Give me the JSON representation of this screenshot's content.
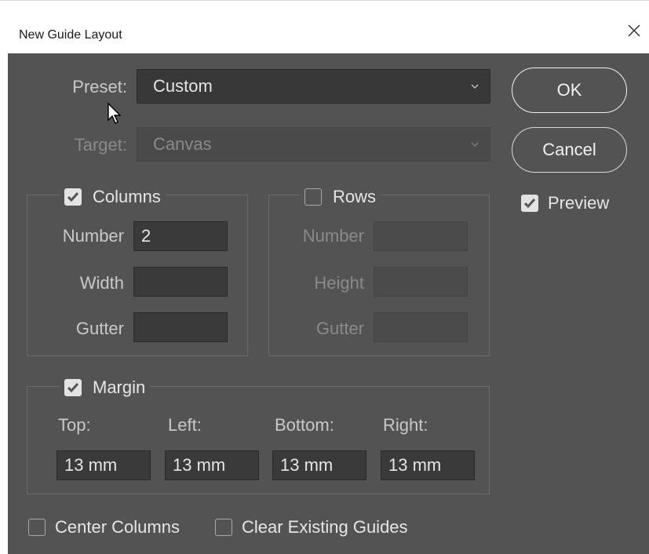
{
  "window": {
    "title": "New Guide Layout"
  },
  "preset": {
    "label": "Preset:",
    "value": "Custom"
  },
  "target": {
    "label": "Target:",
    "value": "Canvas"
  },
  "buttons": {
    "ok": "OK",
    "cancel": "Cancel"
  },
  "preview": {
    "label": "Preview",
    "checked": true
  },
  "columns": {
    "label": "Columns",
    "checked": true,
    "number_label": "Number",
    "number_value": "2",
    "width_label": "Width",
    "width_value": "",
    "gutter_label": "Gutter",
    "gutter_value": ""
  },
  "rows": {
    "label": "Rows",
    "checked": false,
    "number_label": "Number",
    "number_value": "",
    "height_label": "Height",
    "height_value": "",
    "gutter_label": "Gutter",
    "gutter_value": ""
  },
  "margin": {
    "label": "Margin",
    "checked": true,
    "top_label": "Top:",
    "left_label": "Left:",
    "bottom_label": "Bottom:",
    "right_label": "Right:",
    "top_value": "13 mm",
    "left_value": "13 mm",
    "bottom_value": "13 mm",
    "right_value": "13 mm"
  },
  "options": {
    "center_columns": {
      "label": "Center Columns",
      "checked": false
    },
    "clear_existing_guides": {
      "label": "Clear Existing Guides",
      "checked": false
    }
  },
  "colors": {
    "panel": "#535353",
    "field": "#383838",
    "text": "#c9c9c9",
    "checkmark": "#535353"
  },
  "icons": {
    "close": "close-icon",
    "caret": "chevron-down-icon",
    "check": "checkmark-icon",
    "cursor": "mouse-pointer-icon"
  }
}
